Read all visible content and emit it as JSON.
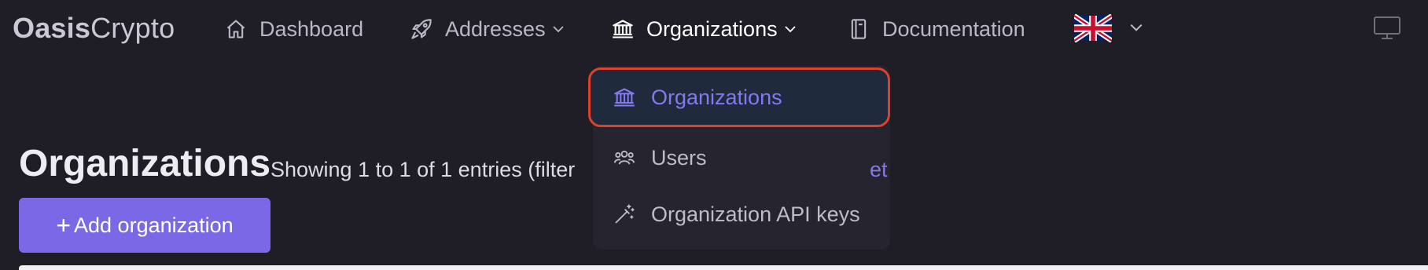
{
  "brand": {
    "bold": "Oasis",
    "light": "Crypto"
  },
  "nav": {
    "dashboard": {
      "label": "Dashboard",
      "icon": "home-icon"
    },
    "addresses": {
      "label": "Addresses",
      "icon": "rocket-icon"
    },
    "organizations": {
      "label": "Organizations",
      "icon": "bank-icon"
    },
    "documentation": {
      "label": "Documentation",
      "icon": "book-icon"
    },
    "language": {
      "icon": "uk-flag-icon"
    },
    "display_icon": "monitor-icon"
  },
  "dropdown": {
    "items": [
      {
        "label": "Organizations",
        "icon": "bank-icon",
        "selected": true
      },
      {
        "label": "Users",
        "icon": "users-icon",
        "selected": false
      },
      {
        "label": "Organization API keys",
        "icon": "magic-wand-icon",
        "selected": false
      }
    ]
  },
  "page": {
    "title": "Organizations",
    "subtitle": "Showing 1 to 1 of 1 entries (filter",
    "subtitle_link": "et",
    "add_button": "Add organization"
  },
  "colors": {
    "background": "#1f1d26",
    "accent": "#7b68e6",
    "highlight_border": "#e0412b",
    "selected_bg": "#1f2a3c"
  }
}
